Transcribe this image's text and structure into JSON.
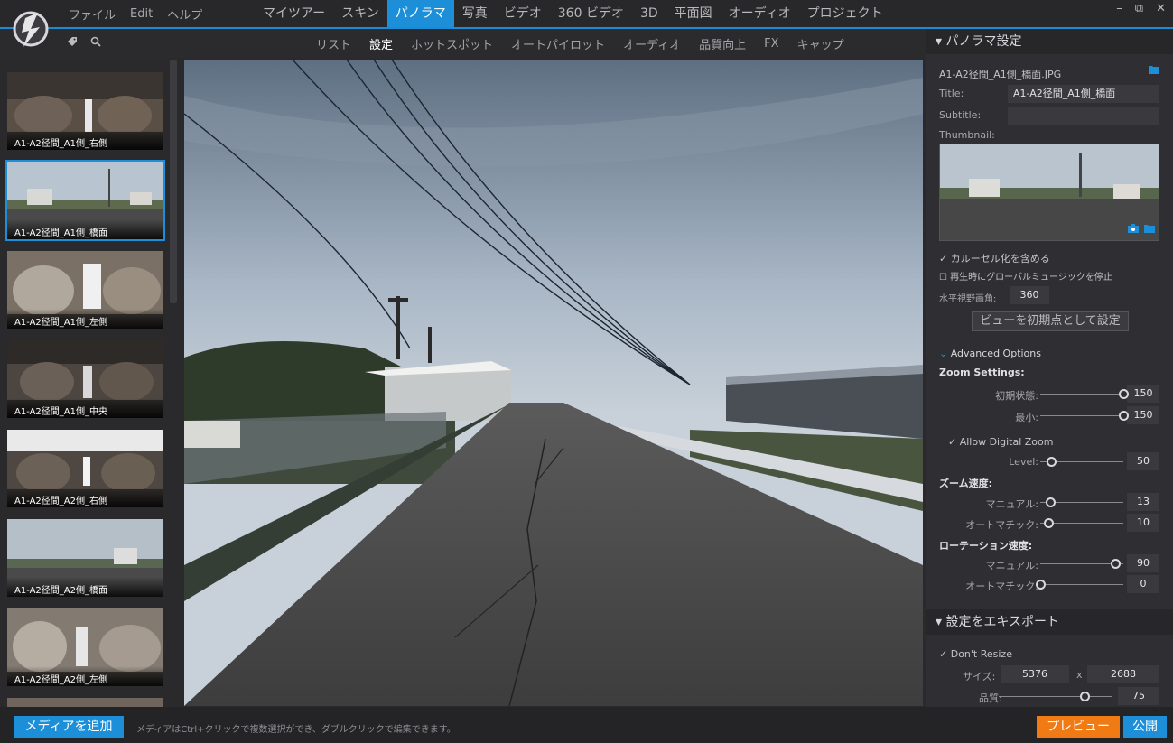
{
  "menu": {
    "file": "ファイル",
    "edit": "Edit",
    "help": "ヘルプ"
  },
  "tabs": [
    "マイツアー",
    "スキン",
    "パノラマ",
    "写真",
    "ビデオ",
    "360 ビデオ",
    "3D",
    "平面図",
    "オーディオ",
    "プロジェクト"
  ],
  "active_tab": "パノラマ",
  "subtabs": [
    "リスト",
    "設定",
    "ホットスポット",
    "オートパイロット",
    "オーディオ",
    "品質向上",
    "FX",
    "キャップ"
  ],
  "active_subtab": "設定",
  "thumbnails": [
    {
      "label": "A1-A2径間_A1側_右側",
      "selected": false
    },
    {
      "label": "A1-A2径間_A1側_橋面",
      "selected": true
    },
    {
      "label": "A1-A2径間_A1側_左側",
      "selected": false
    },
    {
      "label": "A1-A2径間_A1側_中央",
      "selected": false
    },
    {
      "label": "A1-A2径間_A2側_右側",
      "selected": false
    },
    {
      "label": "A1-A2径間_A2側_橋面",
      "selected": false
    },
    {
      "label": "A1-A2径間_A2側_左側",
      "selected": false
    }
  ],
  "panel": {
    "header": "▾ パノラマ設定",
    "filename": "A1-A2径間_A1側_橋面.JPG",
    "title_label": "Title:",
    "title_value": "A1-A2径間_A1側_橋面",
    "subtitle_label": "Subtitle:",
    "subtitle_value": "",
    "thumbnail_label": "Thumbnail:",
    "carousel": "カルーセル化を含める",
    "stop_music": "再生時にグローバルミュージックを停止",
    "hfov_label": "水平視野画角:",
    "hfov_value": "360",
    "set_initial_view": "ビューを初期点として設定",
    "advanced": "Advanced Options",
    "zoom_settings": "Zoom Settings:",
    "zoom_initial_label": "初期状態:",
    "zoom_initial": "150",
    "zoom_min_label": "最小:",
    "zoom_min": "150",
    "digital_zoom": "Allow Digital Zoom",
    "level_label": "Level:",
    "level": "50",
    "zoom_speed": "ズーム速度:",
    "manual_label": "マニュアル:",
    "zoom_manual": "13",
    "auto_label": "オートマチック:",
    "zoom_auto": "10",
    "rotation_speed": "ローテーション速度:",
    "rot_manual": "90",
    "rot_auto": "0"
  },
  "export": {
    "header": "▾ 設定をエキスポート",
    "dont_resize": "Don't Resize",
    "size_label": "サイズ:",
    "width": "5376",
    "times": "x",
    "height": "2688",
    "quality_label": "品質:",
    "quality": "75"
  },
  "bottom": {
    "add_media": "メディアを追加",
    "hint": "メディアはCtrl+クリックで複数選択ができ、ダブルクリックで編集できます。",
    "preview": "プレビュー",
    "publish": "公開"
  },
  "colors": {
    "accent": "#1c8fd8",
    "preview": "#f07a14"
  },
  "sliders": {
    "zoom_initial": 1.0,
    "zoom_min": 1.0,
    "level": 0.13,
    "zoom_manual": 0.12,
    "zoom_auto": 0.1,
    "rot_manual": 0.9,
    "rot_auto": 0.0,
    "quality": 0.75
  }
}
